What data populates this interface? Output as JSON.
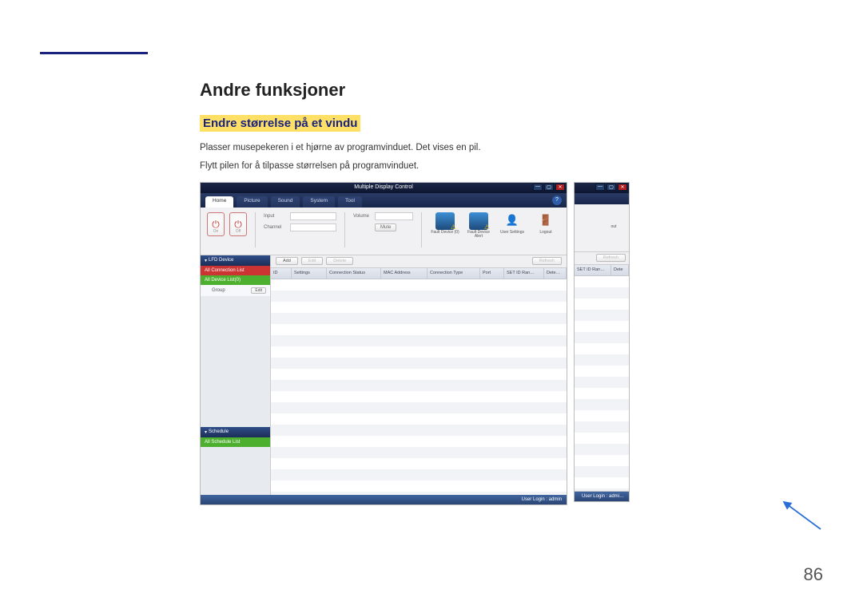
{
  "page": {
    "number": "86",
    "h1": "Andre funksjoner",
    "h2": "Endre størrelse på et vindu",
    "p1": "Plasser musepekeren i et hjørne av programvinduet. Det vises en pil.",
    "p2": "Flytt pilen for å tilpasse størrelsen på programvinduet."
  },
  "app": {
    "title": "Multiple Display Control",
    "tabs": {
      "home": "Home",
      "picture": "Picture",
      "sound": "Sound",
      "system": "System",
      "tool": "Tool"
    },
    "help_glyph": "?",
    "power_on": "On",
    "power_off": "Off",
    "fields": {
      "input": "Input",
      "channel": "Channel",
      "volume": "Volume",
      "mute": "Mute"
    },
    "tools": {
      "fault_device": "Fault Device (0)",
      "fault_alert": "Fault Device Alert",
      "user_settings": "User Settings",
      "logout": "Logout"
    },
    "sidebar": {
      "lfd": "LFD Device",
      "all_conn": "All Connection List",
      "all_dev": "All Device List(0)",
      "group": "Group",
      "edit": "Edit",
      "schedule": "Schedule",
      "all_sched": "All Schedule List"
    },
    "listbar": {
      "add": "Add",
      "edit": "Edit",
      "delete": "Delete",
      "refresh": "Refresh"
    },
    "columns": {
      "id": "ID",
      "settings": "Settings",
      "conn": "Connection Status",
      "mac": "MAC Address",
      "ctype": "Connection Type",
      "port": "Port",
      "setid": "SET ID Ran…",
      "dete": "Dete…",
      "side_setid": "SET ID Ran…",
      "side_dete": "Dete"
    },
    "status": "User Login : admin",
    "status_side": "User Login : admi…",
    "side_tool": "out"
  }
}
